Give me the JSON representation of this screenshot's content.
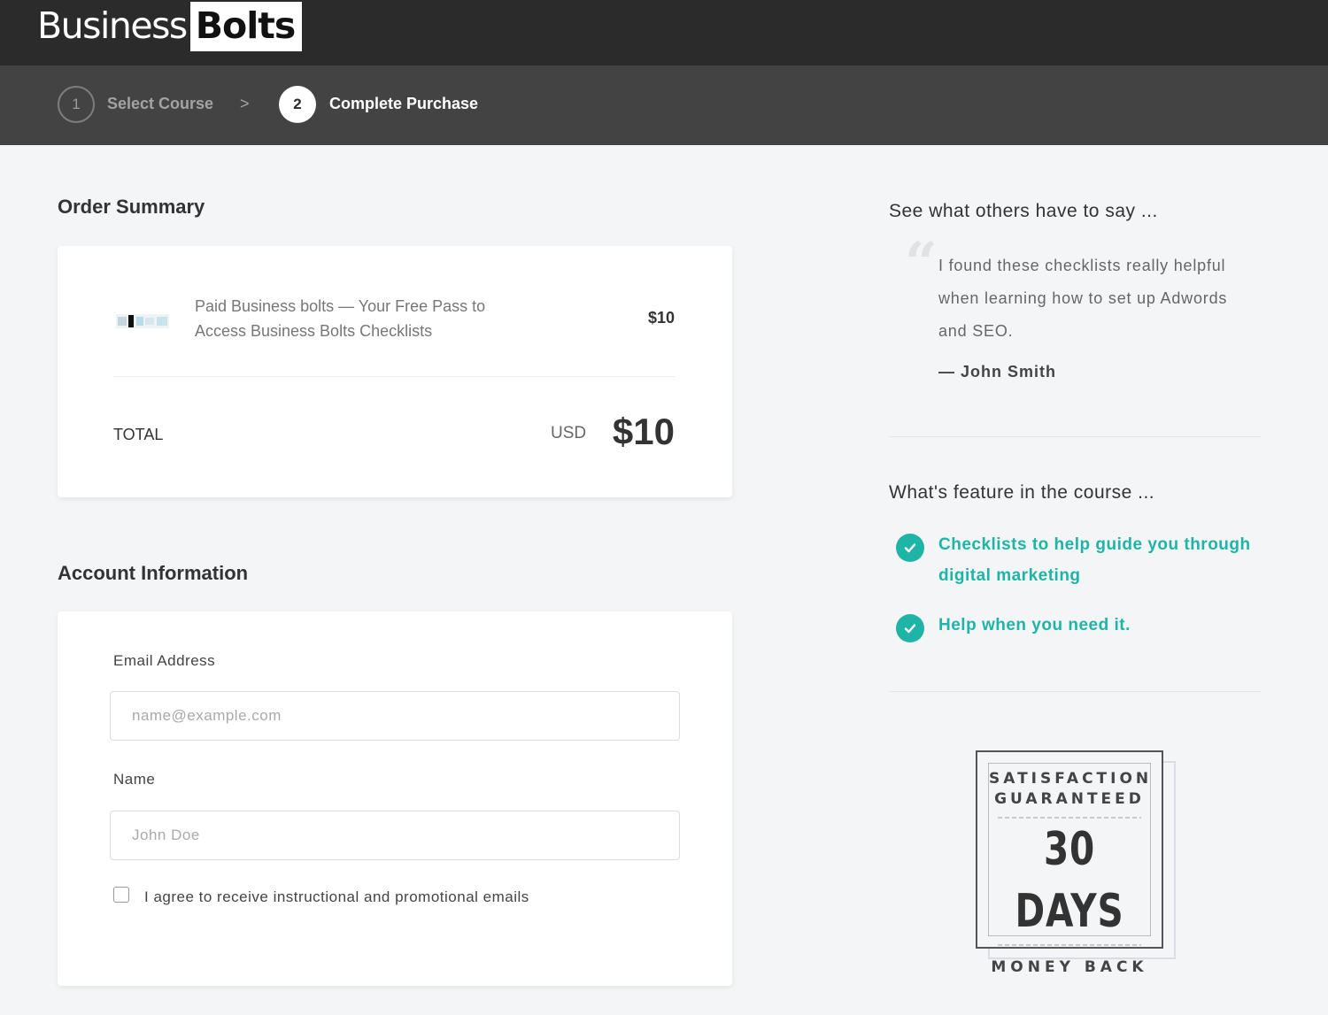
{
  "header": {
    "logo_part1": "Business",
    "logo_part2": "Bolts"
  },
  "steps": [
    {
      "number": "1",
      "label": "Select Course"
    },
    {
      "number": "2",
      "label": "Complete Purchase"
    }
  ],
  "step_separator": ">",
  "order_summary": {
    "heading": "Order Summary",
    "product_name": "Paid Business bolts — Your Free Pass to Access Business Bolts Checklists",
    "product_price": "$10",
    "total_label": "TOTAL",
    "currency": "USD",
    "total_amount": "$10"
  },
  "account": {
    "heading": "Account Information",
    "email_label": "Email Address",
    "email_placeholder": "name@example.com",
    "email_value": "",
    "name_label": "Name",
    "name_placeholder": "John Doe",
    "name_value": "",
    "agree_label": "I agree to receive instructional and promotional emails",
    "agree_checked": false
  },
  "testimonials": {
    "heading": "See what others have to say ...",
    "quote_mark": "“",
    "quote": "I found these checklists really helpful when learning how to set up Adwords and SEO.",
    "author": "— John Smith"
  },
  "features": {
    "heading": "What's feature in the course ...",
    "items": [
      "Checklists to help guide you through digital marketing",
      "Help when you need it."
    ]
  },
  "guarantee": {
    "line1": "SATISFACTION",
    "line2": "GUARANTEED",
    "days": "30 DAYS",
    "money_back": "MONEY BACK"
  },
  "colors": {
    "accent": "#1fb5a6",
    "topbar": "#2b2b2b",
    "stepbar": "#434343",
    "page_bg": "#f4f5f6"
  }
}
